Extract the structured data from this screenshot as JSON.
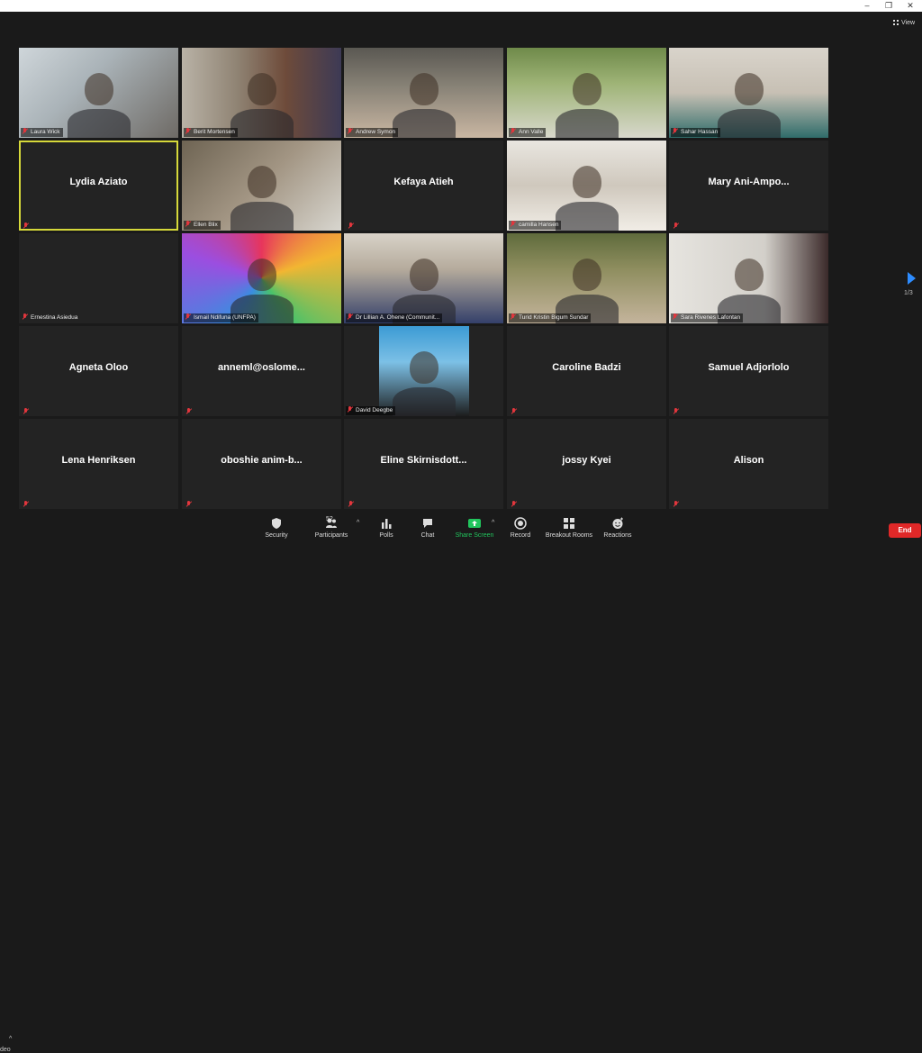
{
  "window": {
    "minimize": "–",
    "maximize": "❐",
    "close": "✕"
  },
  "view_button": {
    "label": "View"
  },
  "pager": {
    "text": "1/3"
  },
  "tiles": [
    {
      "name": "Laura Wick",
      "video": true
    },
    {
      "name": "Berit Mortensen",
      "video": true
    },
    {
      "name": "Andrew Symon",
      "video": true
    },
    {
      "name": "Ann Valle",
      "video": true
    },
    {
      "name": "Sahar Hassan",
      "video": true
    },
    {
      "name": "Lydia Aziato",
      "video": false,
      "active": true
    },
    {
      "name": "Ellen Blix",
      "video": true
    },
    {
      "name": "Kefaya Atieh",
      "video": false
    },
    {
      "name": "camilla Hansen",
      "video": true
    },
    {
      "name": "Mary  Ani-Ampo...",
      "video": false
    },
    {
      "name": "Ernestina Asiedua",
      "video": false,
      "tag_only": true
    },
    {
      "name": "Ismail Ndifuna (UNFPA)",
      "video": true
    },
    {
      "name": "Dr Lillian A. Ohene (Communit...",
      "video": true
    },
    {
      "name": "Turid Kristin Bigum Sundar",
      "video": true
    },
    {
      "name": "Sara Rivenes Lafontan",
      "video": true
    },
    {
      "name": "Agneta Oloo",
      "video": false
    },
    {
      "name": "anneml@oslome...",
      "video": false
    },
    {
      "name": "David Deegbe",
      "video": true
    },
    {
      "name": "Caroline Badzi",
      "video": false
    },
    {
      "name": "Samuel Adjorlolo",
      "video": false
    },
    {
      "name": "Lena Henriksen",
      "video": false
    },
    {
      "name": "oboshie  anim-b...",
      "video": false
    },
    {
      "name": "Eline  Skirnisdott...",
      "video": false
    },
    {
      "name": "jossy Kyei",
      "video": false
    },
    {
      "name": "Alison",
      "video": false
    }
  ],
  "toolbar": {
    "left_edge": "deo",
    "security": "Security",
    "participants": "Participants",
    "participants_count": "52",
    "polls": "Polls",
    "chat": "Chat",
    "share_screen": "Share Screen",
    "record": "Record",
    "breakout": "Breakout Rooms",
    "reactions": "Reactions",
    "end": "End",
    "caret": "^"
  },
  "colors": {
    "accent": "#2d8cff",
    "share_green": "#21c55d",
    "end_red": "#e02828",
    "active_border": "#d6d93a",
    "muted_red": "#e2363d"
  }
}
